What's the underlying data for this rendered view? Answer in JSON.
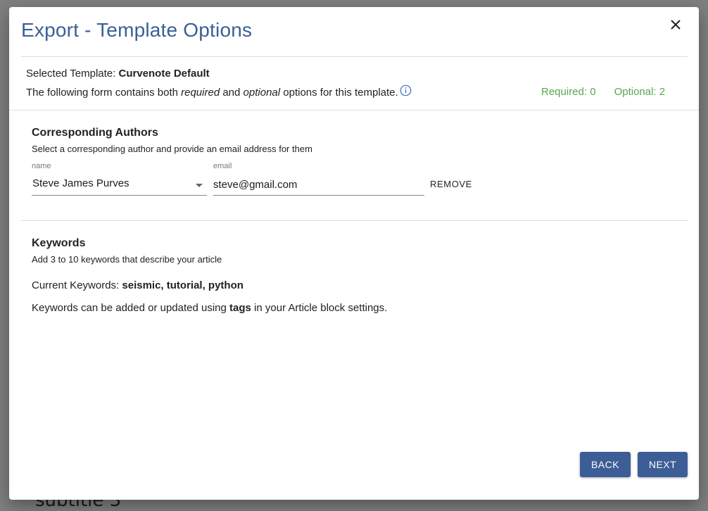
{
  "backdrop": {
    "text": "subtitle 3"
  },
  "dialog": {
    "title": "Export - Template Options",
    "close_icon": "close-icon"
  },
  "template": {
    "selected_label": "Selected Template: ",
    "selected_name": "Curvenote Default",
    "desc_part1": "The following form contains both ",
    "desc_required": "required",
    "desc_part2": " and ",
    "desc_optional": "optional",
    "desc_part3": " options for this template.",
    "info_icon": "info-icon",
    "required_count": "Required: 0",
    "optional_count": "Optional: 2"
  },
  "authors": {
    "title": "Corresponding Authors",
    "subtitle": "Select a corresponding author and provide an email address for them",
    "name_label": "name",
    "name_value": "Steve James Purves",
    "email_label": "email",
    "email_value": "steve@gmail.com",
    "remove_label": "REMOVE"
  },
  "keywords": {
    "title": "Keywords",
    "subtitle": "Add 3 to 10 keywords that describe your article",
    "current_label": "Current Keywords: ",
    "current_values": "seismic, tutorial, python",
    "note_part1": "Keywords can be added or updated using ",
    "note_bold": "tags",
    "note_part2": " in your Article block settings."
  },
  "actions": {
    "back_label": "BACK",
    "next_label": "NEXT"
  },
  "colors": {
    "title": "#3a5f97",
    "accent_button": "#3d5d96",
    "counts_green": "#5aa452"
  }
}
